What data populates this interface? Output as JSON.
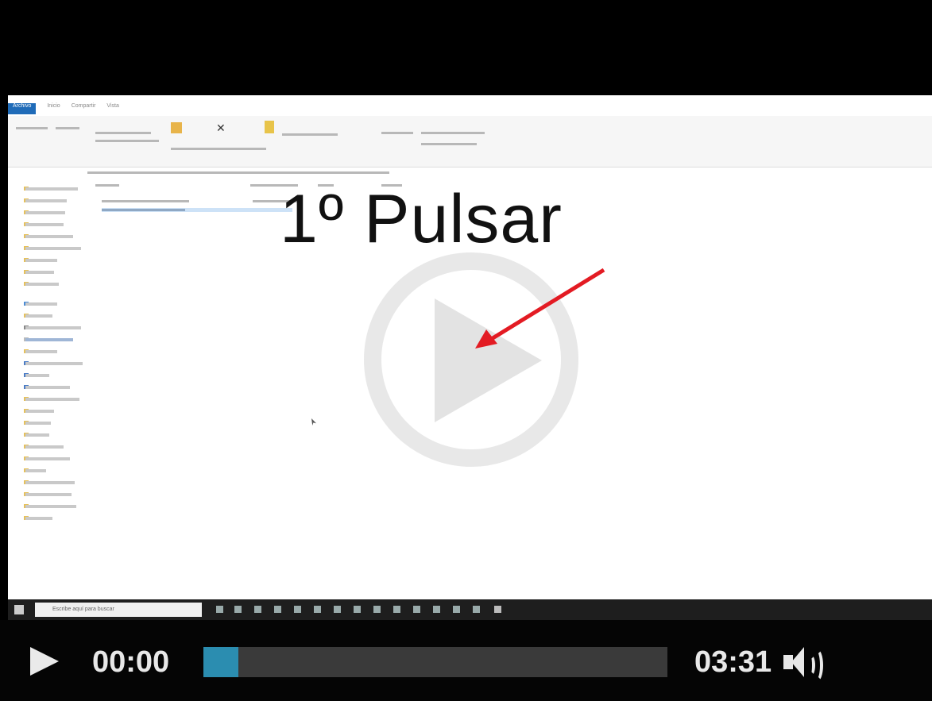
{
  "explorer": {
    "ribbon_tabs": [
      "Archivo",
      "Inicio",
      "Compartir",
      "Vista"
    ],
    "search_placeholder": "Escribe aquí para buscar"
  },
  "overlay": {
    "caption": "1º Pulsar",
    "arrow_color": "#e31b23"
  },
  "player": {
    "current_time": "00:00",
    "duration": "03:31",
    "progress": 0.075,
    "accent_color": "#2b8db0",
    "icons": [
      "play-icon",
      "volume-icon"
    ]
  }
}
